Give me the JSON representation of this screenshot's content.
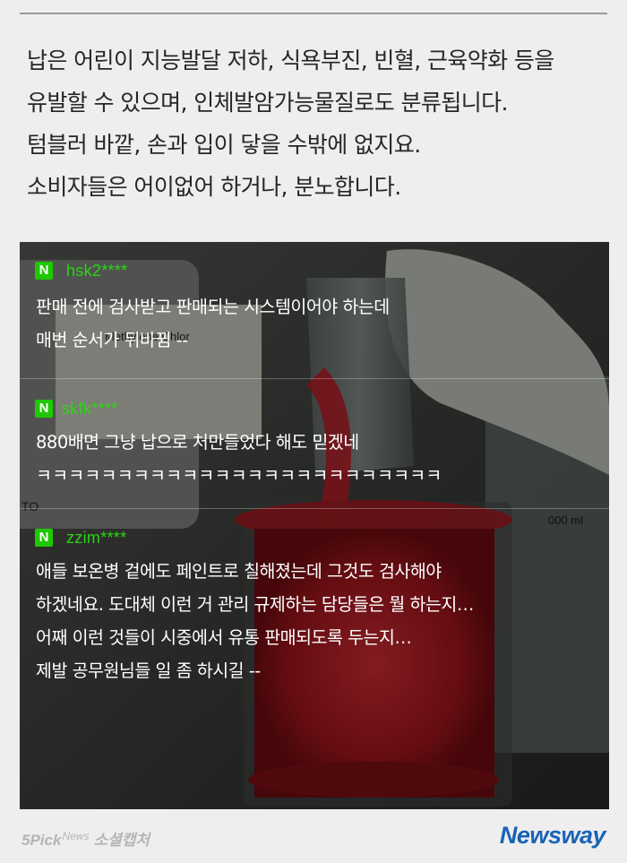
{
  "intro": {
    "lines": [
      "납은 어린이 지능발달 저하, 식욕부진, 빈혈, 근육약화 등을",
      "유발할 수 있으며, 인체발암가능물질로도 분류됩니다.",
      "텀블러 바깥, 손과 입이 닿을 수밖에 없지요.",
      "소비자들은 어이없어 하거나, 분노합니다."
    ]
  },
  "photo": {
    "bottle_label_text": "Methylene Chlor",
    "beaker_marking": "000 ml",
    "side_label_fragment": "TO"
  },
  "comments": [
    {
      "badge": "N",
      "username": "hsk2****",
      "lines": [
        "판매 전에 검사받고 판매되는 시스템이어야 하는데",
        "매번 순서가 뒤바뀜 --"
      ]
    },
    {
      "badge": "N",
      "username": "skfk****",
      "lines": [
        "880배면 그냥 납으로 처만들었다 해도 믿겠네",
        "ㅋㅋㅋㅋㅋㅋㅋㅋㅋㅋㅋㅋㅋㅋㅋㅋㅋㅋㅋㅋㅋㅋㅋㅋㅋ"
      ]
    },
    {
      "badge": "N",
      "username": "zzim****",
      "lines": [
        "애들 보온병 겉에도 페인트로 칠해졌는데 그것도 검사해야",
        "하겠네요. 도대체 이런 거 관리 규제하는 담당들은 뭘 하는지…",
        "어째 이런 것들이 시중에서 유통 판매되도록 두는지…",
        "제발 공무원님들 일 좀 하시길 --"
      ]
    }
  ],
  "footer": {
    "left_brand": "5Pick",
    "left_brand_sup": "News",
    "left_brand_section": "소셜캡처",
    "right_brand": "Newsway"
  },
  "colors": {
    "page_bg": "#eeeeee",
    "intro_text": "#262626",
    "naver_green": "#1ec800",
    "username_green": "#2bd515",
    "newsway_blue": "#1a63b8",
    "paint_red": "#c8202a"
  }
}
